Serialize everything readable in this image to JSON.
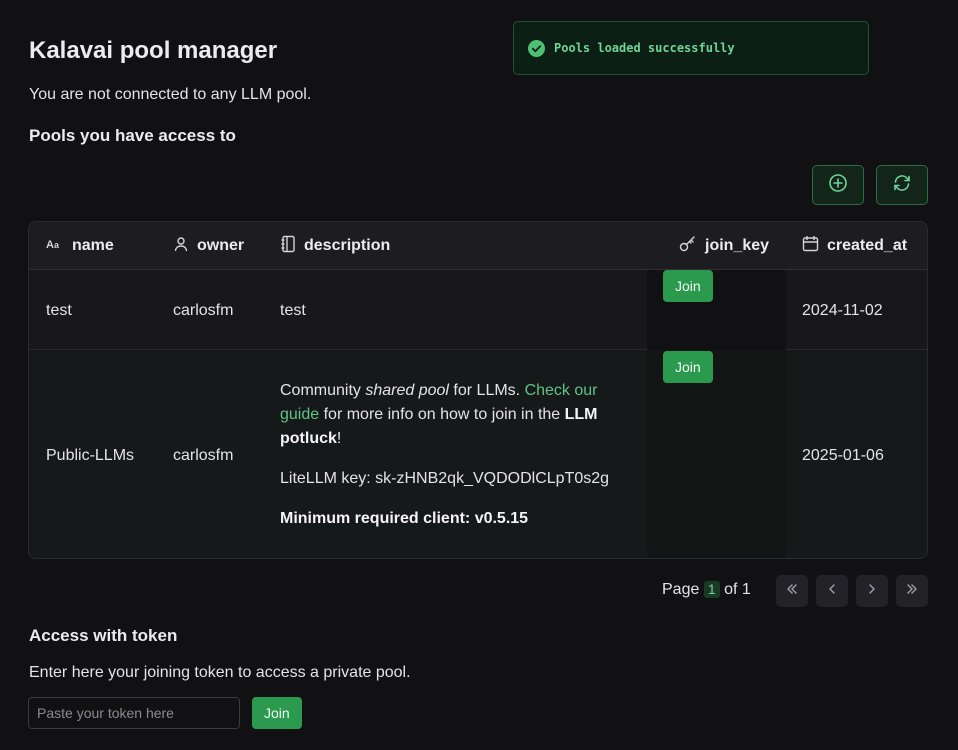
{
  "header": {
    "title": "Kalavai pool manager",
    "status": "You are not connected to any LLM pool.",
    "pools_heading": "Pools you have access to"
  },
  "toast": {
    "message": "Pools loaded successfully",
    "icon": "check-circle-icon",
    "color": "#4cc174"
  },
  "toolbar": {
    "add_icon": "plus-circle-icon",
    "refresh_icon": "refresh-icon"
  },
  "table": {
    "columns": [
      {
        "label": "name",
        "icon": "text-icon"
      },
      {
        "label": "owner",
        "icon": "user-icon"
      },
      {
        "label": "description",
        "icon": "notebook-icon"
      },
      {
        "label": "join_key",
        "icon": "key-icon"
      },
      {
        "label": "created_at",
        "icon": "calendar-icon"
      }
    ],
    "rows": [
      {
        "name": "test",
        "owner": "carlosfm",
        "description": "test",
        "join_label": "Join",
        "created_at": "2024-11-02"
      },
      {
        "name": "Public-LLMs",
        "owner": "carlosfm",
        "description": {
          "p1_a": "Community ",
          "p1_em": "shared pool",
          "p1_b": " for LLMs. ",
          "p1_link": "Check our guide",
          "p1_c": " for more info on how to join in the ",
          "p1_strong": "LLM potluck",
          "p1_d": "!",
          "p2": "LiteLLM key: sk-zHNB2qk_VQDODlCLpT0s2g",
          "p3": "Minimum required client: v0.5.15"
        },
        "join_label": "Join",
        "created_at": "2025-01-06"
      }
    ]
  },
  "pagination": {
    "page_label": "Page",
    "current": "1",
    "of_label": "of 1"
  },
  "token": {
    "heading": "Access with token",
    "text": "Enter here your joining token to access a private pool.",
    "placeholder": "Paste your token here",
    "join_label": "Join"
  },
  "colors": {
    "accent": "#2b9a4f",
    "background": "#111113"
  }
}
